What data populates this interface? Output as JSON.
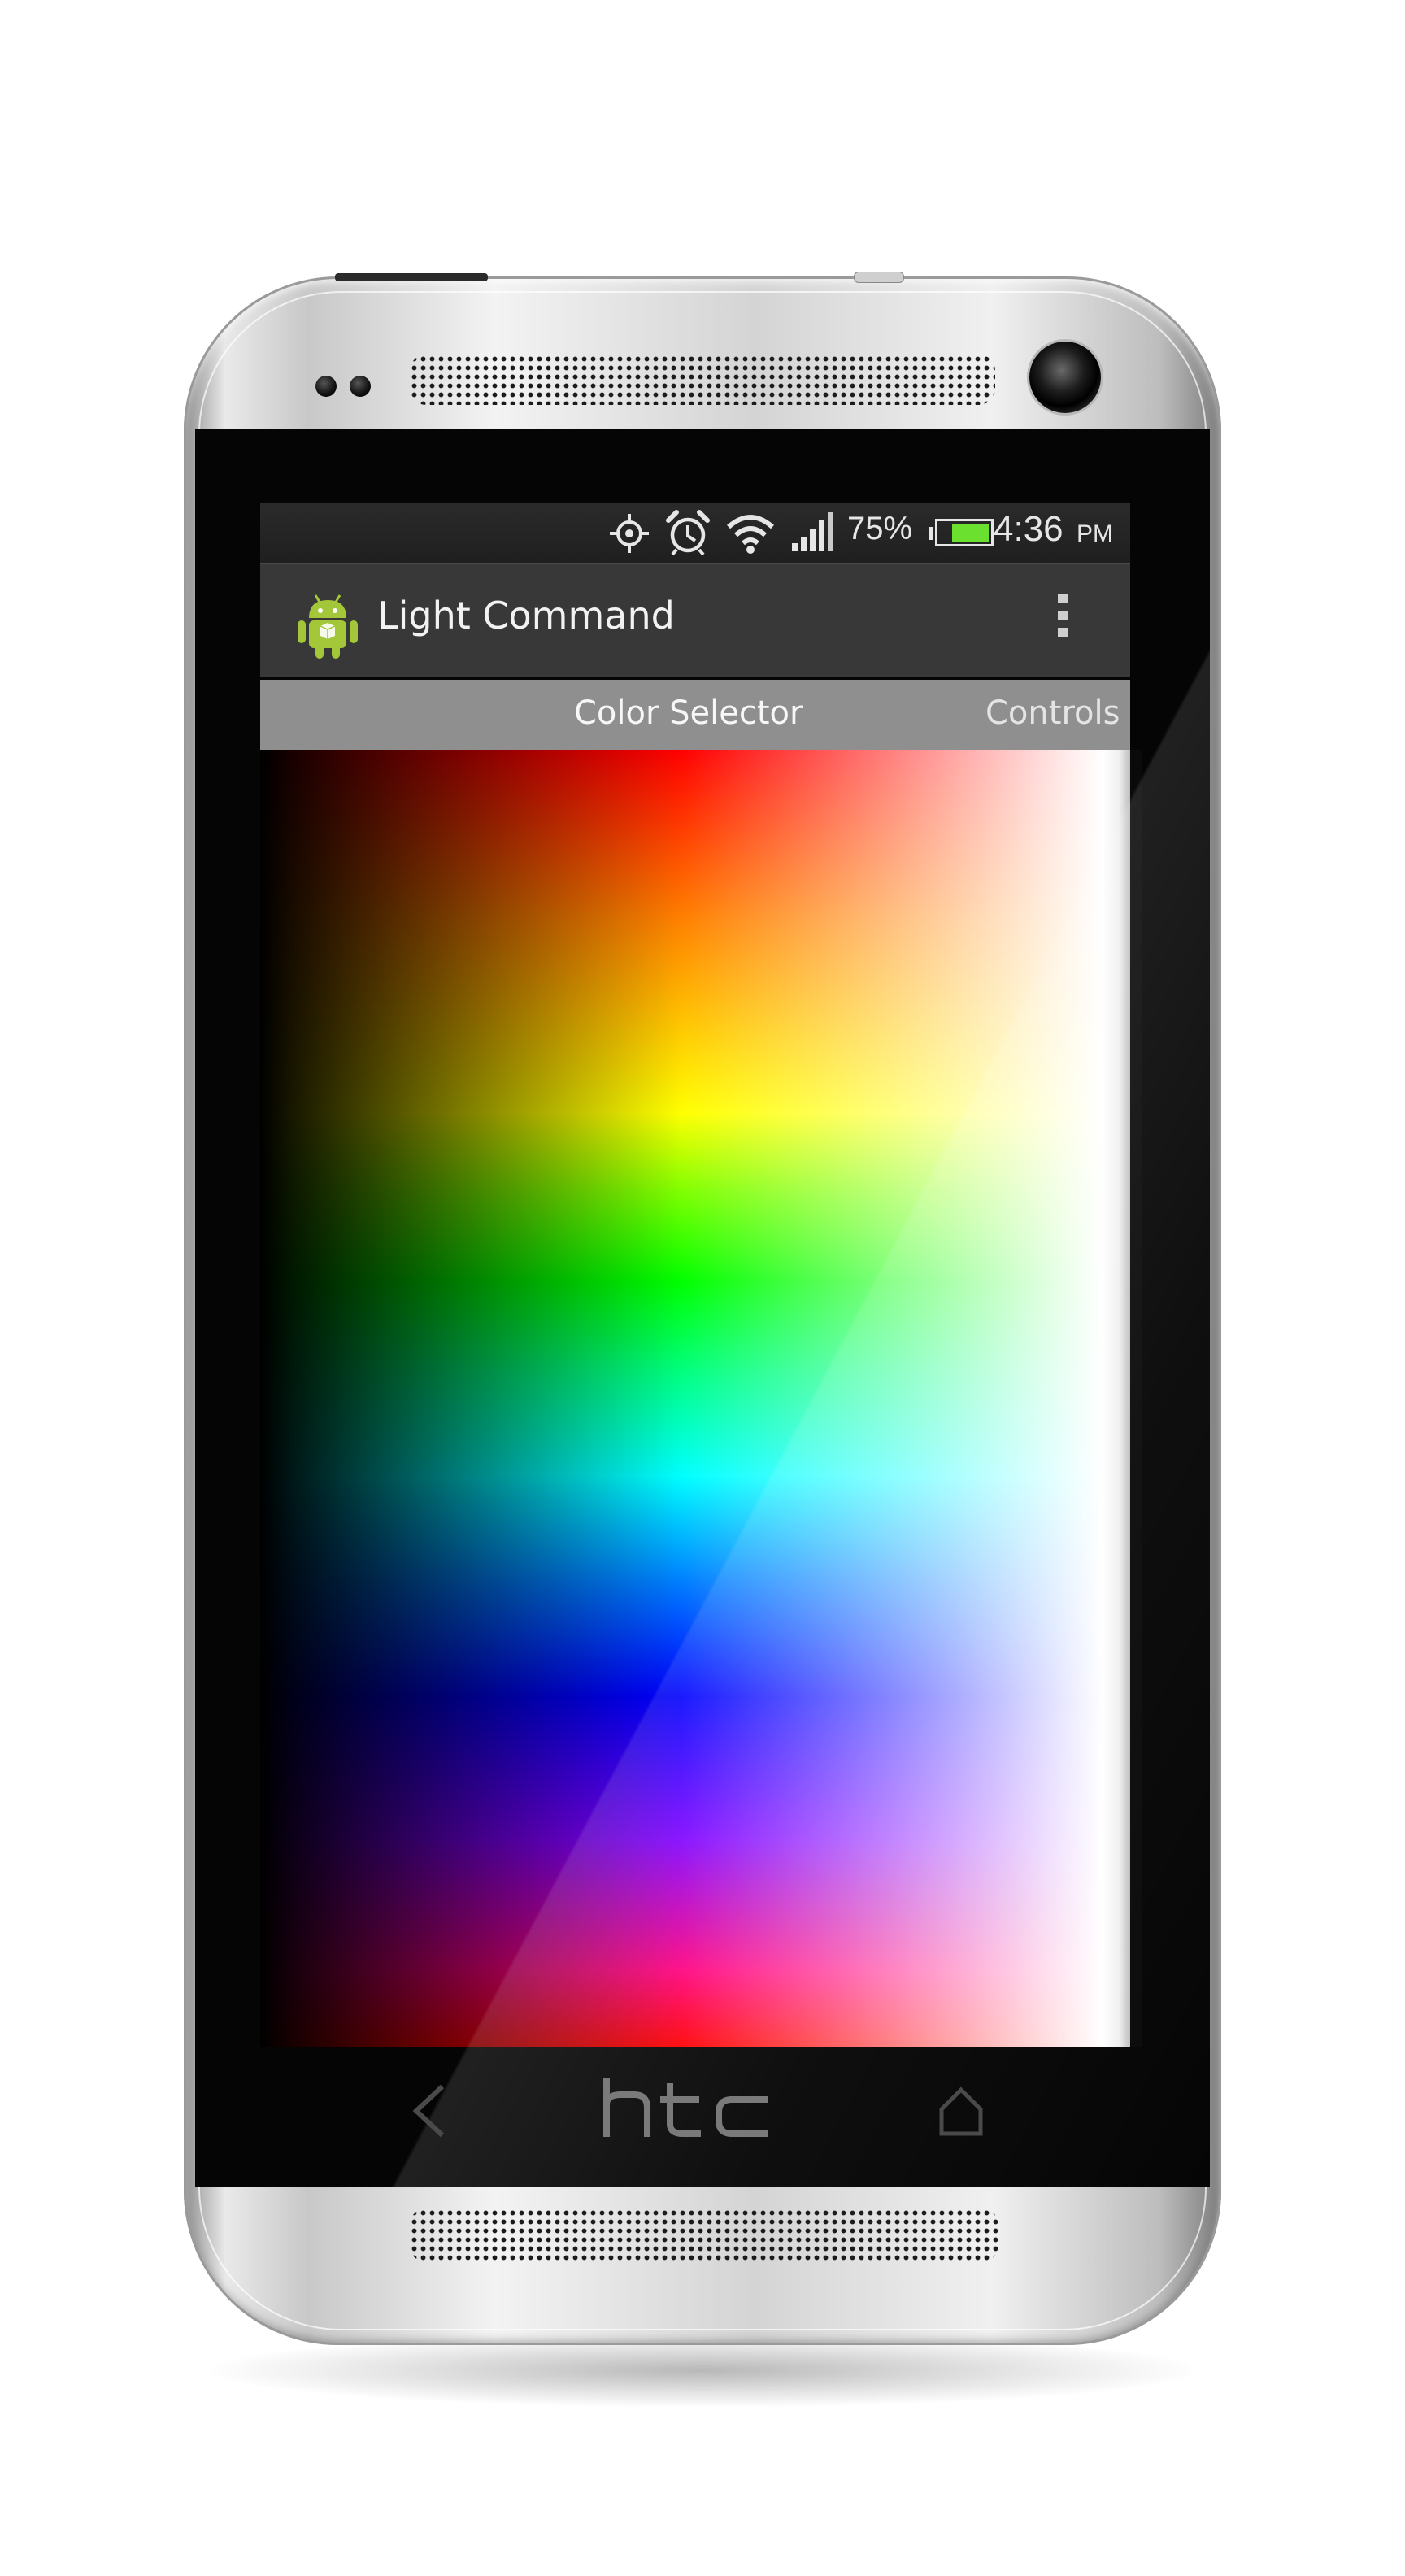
{
  "status_bar": {
    "icons": [
      "gps-icon",
      "alarm-icon",
      "wifi-icon",
      "signal-icon",
      "battery-icon"
    ],
    "battery": "75%",
    "battery_level": 0.75,
    "time": "4:36",
    "ampm": "PM"
  },
  "action_bar": {
    "app_icon": "android-app-icon",
    "title": "Light Command",
    "overflow_icon": "overflow-menu-icon"
  },
  "tabs": [
    {
      "label": "Color Selector",
      "selected": true
    },
    {
      "label": "Controls",
      "selected": false
    }
  ],
  "device": {
    "brand": "htc",
    "nav": [
      "back-icon",
      "home-icon"
    ]
  },
  "colors": {
    "status_bar_bg": "#2b2b2b",
    "action_bar_bg": "#383838",
    "tab_strip_bg": "#8f8f8f",
    "battery_fill": "#6ce02e",
    "android_green": "#a4c639"
  }
}
